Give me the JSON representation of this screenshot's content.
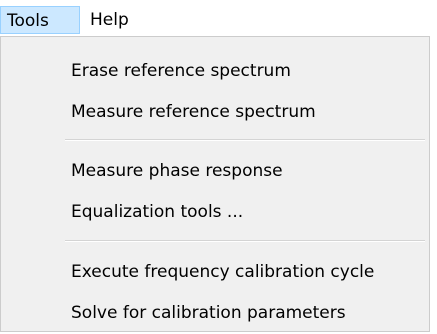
{
  "menubar": {
    "items": [
      {
        "label": "Tools"
      },
      {
        "label": "Help"
      }
    ]
  },
  "menu": {
    "items": [
      {
        "label": "Erase reference spectrum"
      },
      {
        "label": "Measure reference spectrum"
      },
      {
        "label": "Measure phase response"
      },
      {
        "label": "Equalization tools ..."
      },
      {
        "label": "Execute frequency calibration cycle"
      },
      {
        "label": "Solve for calibration parameters"
      }
    ]
  },
  "colors": {
    "menu_background": "#f0f0f0",
    "selected_menu_background": "#cce8ff",
    "selected_menu_border": "#99d1ff",
    "separator": "#d4d4d4"
  }
}
